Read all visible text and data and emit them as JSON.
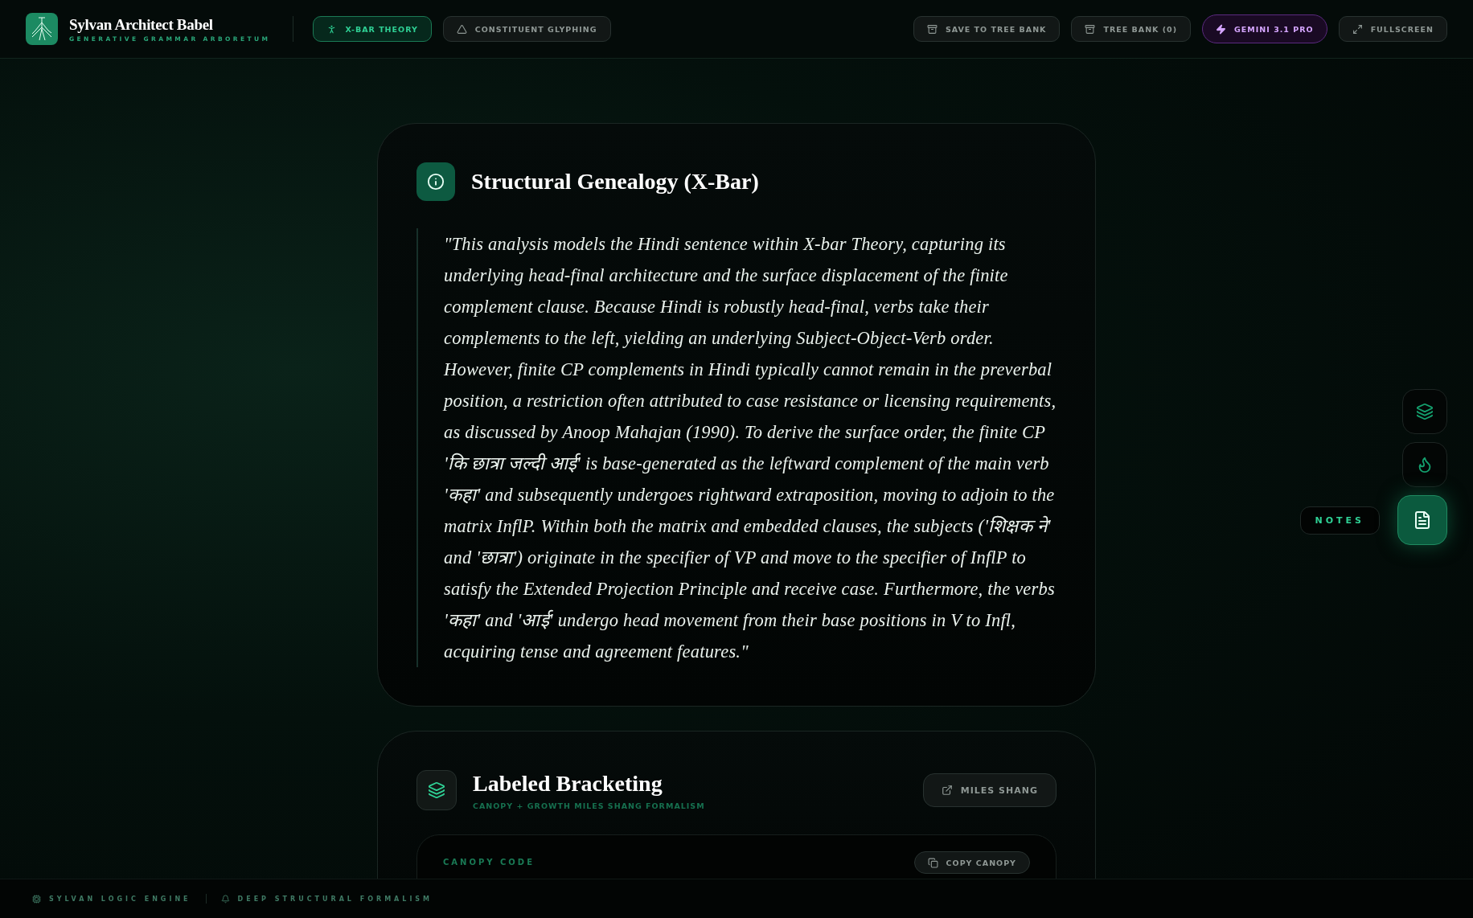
{
  "brand": {
    "title": "Sylvan Architect Babel",
    "subtitle": "GENERATIVE GRAMMAR ARBORETUM"
  },
  "tabs": [
    {
      "label": "X-BAR THEORY",
      "selected": true,
      "kind": "xbar"
    },
    {
      "label": "CONSTITUENT GLYPHING",
      "selected": false,
      "kind": "triangle"
    }
  ],
  "actions": [
    {
      "label": "SAVE TO TREE BANK",
      "kind": "archive"
    },
    {
      "label": "TREE BANK (0)",
      "kind": "archive"
    },
    {
      "label": "GEMINI 3.1 PRO",
      "kind": "model"
    },
    {
      "label": "FULLSCREEN",
      "kind": "expand"
    }
  ],
  "genealogy": {
    "title": "Structural Genealogy (X-Bar)",
    "quote": "\"This analysis models the Hindi sentence within X-bar Theory, capturing its underlying head-final architecture and the surface displacement of the finite complement clause. Because Hindi is robustly head-final, verbs take their complements to the left, yielding an underlying Subject-Object-Verb order. However, finite CP complements in Hindi typically cannot remain in the preverbal position, a restriction often attributed to case resistance or licensing requirements, as discussed by Anoop Mahajan (1990). To derive the surface order, the finite CP 'कि छात्रा जल्दी आई' is base-generated as the leftward complement of the main verb 'कहा' and subsequently undergoes rightward extraposition, moving to adjoin to the matrix InflP. Within both the matrix and embedded clauses, the subjects ('शिक्षक ने' and 'छात्रा') originate in the specifier of VP and move to the specifier of InflP to satisfy the Extended Projection Principle and receive case. Furthermore, the verbs 'कहा' and 'आई' undergo head movement from their base positions in V to Infl, acquiring tense and agreement features.\""
  },
  "bracketing": {
    "title": "Labeled Bracketing",
    "subtitle": "CANOPY + GROWTH MILES SHANG FORMALISM",
    "link": "MILES SHANG",
    "code_label": "CANOPY CODE",
    "copy": "COPY CANOPY"
  },
  "rail": [
    {
      "kind": "layers",
      "selected": false
    },
    {
      "kind": "fire",
      "selected": false
    },
    {
      "kind": "notes",
      "selected": true,
      "tooltip": "NOTES"
    }
  ],
  "status_bar": [
    {
      "label": "SYLVAN LOGIC ENGINE",
      "kind": "cpu"
    },
    {
      "label": "DEEP STRUCTURAL FORMALISM",
      "kind": "bell"
    }
  ]
}
